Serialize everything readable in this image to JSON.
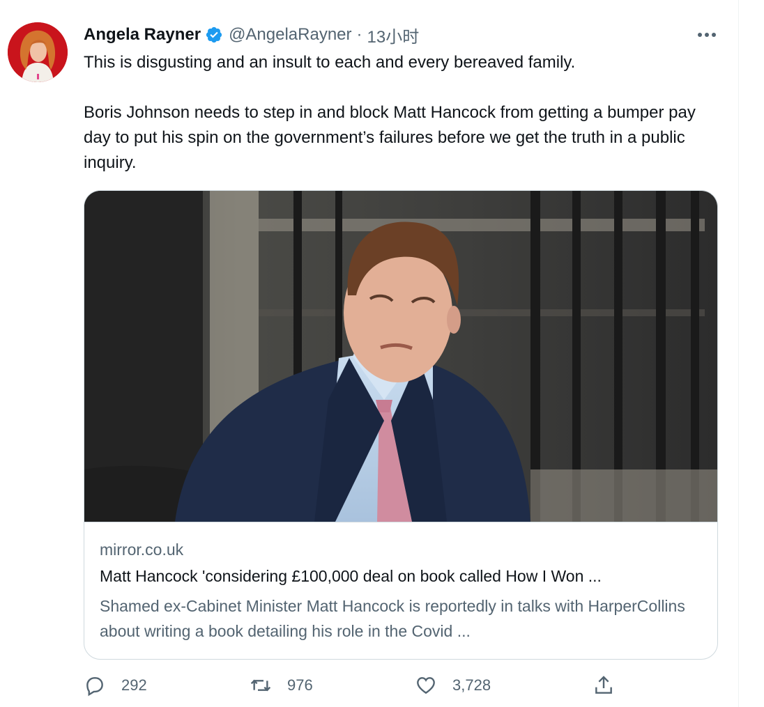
{
  "tweet": {
    "author_name": "Angela Rayner",
    "handle": "@AngelaRayner",
    "separator": "·",
    "time": "13小时",
    "paragraphs": [
      "This is disgusting and an insult to each and every bereaved family.",
      "Boris Johnson needs to step in and block Matt Hancock from getting a bumper pay day to put his spin on the government’s failures before we get the truth in a public inquiry."
    ]
  },
  "card": {
    "domain": "mirror.co.uk",
    "title": "Matt Hancock 'considering £100,000 deal on book called How I Won ...",
    "description": "Shamed ex-Cabinet Minister Matt Hancock is reportedly in talks with HarperCollins about writing a book detailing his role in the Covid ..."
  },
  "actions": {
    "replies": "292",
    "retweets": "976",
    "likes": "3,728"
  },
  "icons": {
    "verified": "verified-badge-icon",
    "more": "more-dots-icon",
    "reply": "reply-icon",
    "retweet": "retweet-icon",
    "like": "heart-icon",
    "share": "share-icon"
  },
  "colors": {
    "verified": "#1d9bf0",
    "secondary_text": "#536471",
    "border": "#cfd9de"
  }
}
